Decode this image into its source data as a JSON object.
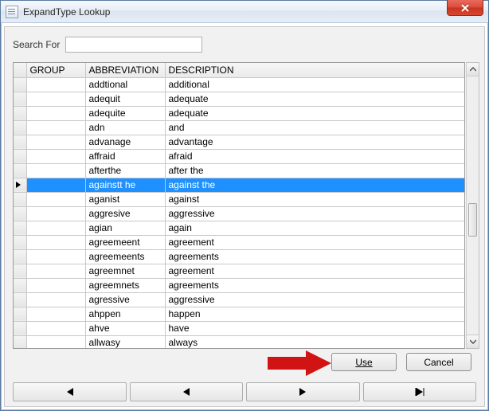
{
  "title": "ExpandType Lookup",
  "search": {
    "label": "Search For",
    "value": ""
  },
  "columns": {
    "group": "GROUP",
    "abbr": "ABBREVIATION",
    "desc": "DESCRIPTION"
  },
  "selectedIndex": 7,
  "rows": [
    {
      "group": "",
      "abbr": "addtional",
      "desc": "additional"
    },
    {
      "group": "",
      "abbr": "adequit",
      "desc": "adequate"
    },
    {
      "group": "",
      "abbr": "adequite",
      "desc": "adequate"
    },
    {
      "group": "",
      "abbr": "adn",
      "desc": "and"
    },
    {
      "group": "",
      "abbr": "advanage",
      "desc": "advantage"
    },
    {
      "group": "",
      "abbr": "affraid",
      "desc": "afraid"
    },
    {
      "group": "",
      "abbr": "afterthe",
      "desc": "after the"
    },
    {
      "group": "",
      "abbr": "againstt he",
      "desc": "against the"
    },
    {
      "group": "",
      "abbr": "aganist",
      "desc": "against"
    },
    {
      "group": "",
      "abbr": "aggresive",
      "desc": "aggressive"
    },
    {
      "group": "",
      "abbr": "agian",
      "desc": "again"
    },
    {
      "group": "",
      "abbr": "agreemeent",
      "desc": "agreement"
    },
    {
      "group": "",
      "abbr": "agreemeents",
      "desc": "agreements"
    },
    {
      "group": "",
      "abbr": "agreemnet",
      "desc": "agreement"
    },
    {
      "group": "",
      "abbr": "agreemnets",
      "desc": "agreements"
    },
    {
      "group": "",
      "abbr": "agressive",
      "desc": "aggressive"
    },
    {
      "group": "",
      "abbr": "ahppen",
      "desc": "happen"
    },
    {
      "group": "",
      "abbr": "ahve",
      "desc": "have"
    },
    {
      "group": "",
      "abbr": "allwasy",
      "desc": "always"
    }
  ],
  "buttons": {
    "use": "Use",
    "cancel": "Cancel"
  },
  "nav_aria": {
    "first": "First",
    "prev": "Previous",
    "next": "Next",
    "last": "Last"
  }
}
